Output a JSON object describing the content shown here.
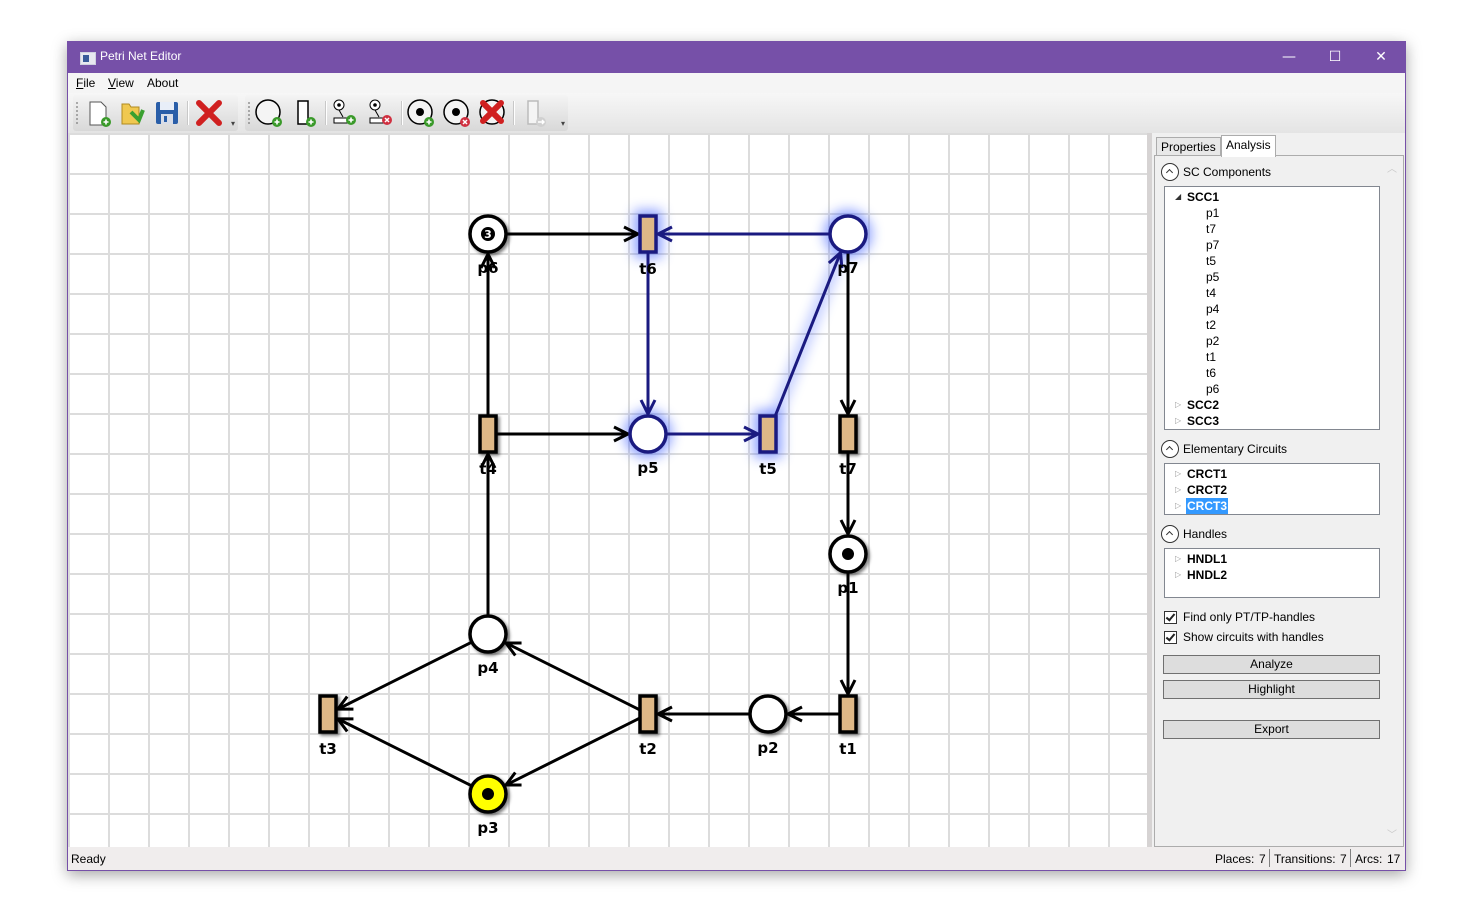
{
  "window": {
    "title": "Petri Net Editor",
    "controls": {
      "minimize": "—",
      "maximize": "☐",
      "close": "✕"
    }
  },
  "menu": [
    {
      "label": "File",
      "accel": "F"
    },
    {
      "label": "View",
      "accel": "V"
    },
    {
      "label": "About"
    }
  ],
  "toolbars": [
    {
      "buttons": [
        "new-file-icon",
        "open-folder-icon",
        "save-icon",
        "delete-icon"
      ]
    },
    {
      "buttons": [
        "add-place-icon",
        "add-transition-icon",
        "add-arc-icon",
        "remove-arc-icon",
        "add-token-icon",
        "remove-token-icon",
        "delete-element-icon",
        "fire-transition-icon"
      ]
    }
  ],
  "colors": {
    "accent": "#7650a8",
    "transition_fill": "#deb887",
    "highlight": "#1a1a80",
    "highlight_glow": "#3355ff",
    "marked_place": "#ffff00",
    "selection": "#3399ff"
  },
  "net": {
    "places": [
      {
        "id": "p1",
        "label": "p1",
        "tokens": 1
      },
      {
        "id": "p2",
        "label": "p2",
        "tokens": 0
      },
      {
        "id": "p3",
        "label": "p3",
        "tokens": 1,
        "state": "marked"
      },
      {
        "id": "p4",
        "label": "p4",
        "tokens": 0
      },
      {
        "id": "p5",
        "label": "p5",
        "tokens": 0,
        "state": "highlighted"
      },
      {
        "id": "p6",
        "label": "p6",
        "tokens": 3,
        "token_text": "3"
      },
      {
        "id": "p7",
        "label": "p7",
        "tokens": 0,
        "state": "highlighted"
      }
    ],
    "transitions": [
      {
        "id": "t1",
        "label": "t1"
      },
      {
        "id": "t2",
        "label": "t2"
      },
      {
        "id": "t3",
        "label": "t3"
      },
      {
        "id": "t4",
        "label": "t4"
      },
      {
        "id": "t5",
        "label": "t5",
        "state": "highlighted"
      },
      {
        "id": "t6",
        "label": "t6",
        "state": "highlighted"
      },
      {
        "id": "t7",
        "label": "t7"
      }
    ],
    "arcs": [
      {
        "from": "p6",
        "to": "t6"
      },
      {
        "from": "p7",
        "to": "t6",
        "state": "highlighted"
      },
      {
        "from": "t6",
        "to": "p5",
        "state": "highlighted"
      },
      {
        "from": "t4",
        "to": "p6"
      },
      {
        "from": "t4",
        "to": "p5"
      },
      {
        "from": "p5",
        "to": "t5",
        "state": "highlighted"
      },
      {
        "from": "t5",
        "to": "p7",
        "state": "highlighted"
      },
      {
        "from": "p7",
        "to": "t7"
      },
      {
        "from": "t7",
        "to": "p1"
      },
      {
        "from": "p1",
        "to": "t1"
      },
      {
        "from": "t1",
        "to": "p2"
      },
      {
        "from": "p2",
        "to": "t2"
      },
      {
        "from": "t2",
        "to": "p4"
      },
      {
        "from": "t2",
        "to": "p3"
      },
      {
        "from": "p4",
        "to": "t4"
      },
      {
        "from": "p4",
        "to": "t3"
      },
      {
        "from": "p3",
        "to": "t3"
      }
    ]
  },
  "panel": {
    "tabs": [
      {
        "label": "Properties",
        "active": false
      },
      {
        "label": "Analysis",
        "active": true
      }
    ],
    "sc_components": {
      "header": "SC Components",
      "items": [
        {
          "label": "SCC1",
          "expanded": true,
          "children": [
            "p1",
            "t7",
            "p7",
            "t5",
            "p5",
            "t4",
            "p4",
            "t2",
            "p2",
            "t1",
            "t6",
            "p6"
          ]
        },
        {
          "label": "SCC2",
          "expanded": false
        },
        {
          "label": "SCC3",
          "expanded": false
        }
      ]
    },
    "elementary_circuits": {
      "header": "Elementary Circuits",
      "items": [
        {
          "label": "CRCT1"
        },
        {
          "label": "CRCT2"
        },
        {
          "label": "CRCT3",
          "selected": true
        }
      ]
    },
    "handles": {
      "header": "Handles",
      "items": [
        {
          "label": "HNDL1"
        },
        {
          "label": "HNDL2"
        }
      ]
    },
    "options": [
      {
        "label": "Find only PT/TP-handles",
        "checked": true
      },
      {
        "label": "Show circuits with handles",
        "checked": true
      }
    ],
    "buttons": {
      "analyze": "Analyze",
      "highlight": "Highlight",
      "export": "Export"
    }
  },
  "status": {
    "text": "Ready",
    "places_label": "Places:",
    "places": "7",
    "transitions_label": "Transitions:",
    "transitions": "7",
    "arcs_label": "Arcs:",
    "arcs": "17"
  }
}
